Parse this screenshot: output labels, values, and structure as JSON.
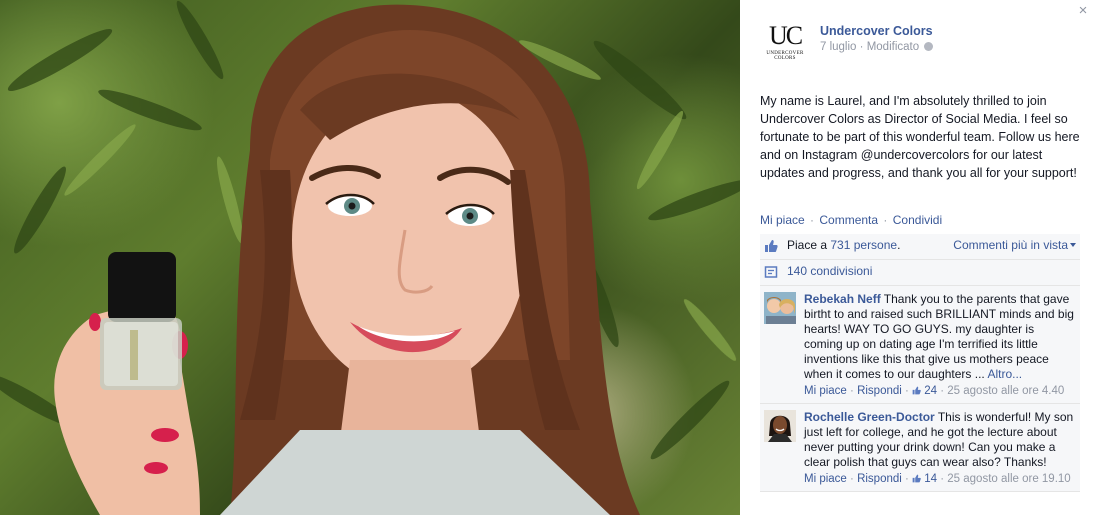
{
  "photo": {
    "subject": "photo"
  },
  "close_label": "×",
  "page": {
    "logo_text": "UC",
    "logo_subtext_1": "UNDERCOVER",
    "logo_subtext_2": "COLORS",
    "name": "Undercover Colors",
    "date": "7 luglio",
    "separator": "·",
    "edited": "Modificato"
  },
  "post": {
    "text": "My name is Laurel, and I'm absolutely thrilled to join Undercover Colors as Director of Social Media. I feel so fortunate to be part of this wonderful team. Follow us here and on Instagram @undercovercolors for our latest updates and progress, and thank you all for your support!"
  },
  "actions": {
    "like": "Mi piace",
    "comment": "Commenta",
    "share": "Condividi",
    "sep": "·"
  },
  "likes": {
    "prefix": "Piace a ",
    "count_link": "731 persone",
    "suffix": ".",
    "order_label": "Commenti più in vista"
  },
  "shares": {
    "label": "140 condivisioni"
  },
  "comments": [
    {
      "author": "Rebekah Neff",
      "text": " Thank you to the parents that gave birtht to and raised such BRILLIANT minds and big hearts! WAY TO GO GUYS. my daughter is coming up on dating age I'm terrified its little inventions like this that give us mothers peace when it comes to our daughters ... ",
      "more": "Altro...",
      "like": "Mi piace",
      "reply": "Rispondi",
      "likes": "24",
      "time": "25 agosto alle ore 4.40",
      "sep": " · "
    },
    {
      "author": "Rochelle Green-Doctor",
      "text": " This is wonderful! My son just left for college, and he got the lecture about never putting your drink down! Can you make a clear polish that guys can wear also? Thanks!",
      "more": "",
      "like": "Mi piace",
      "reply": "Rispondi",
      "likes": "14",
      "time": "25 agosto alle ore 19.10",
      "sep": " · "
    }
  ],
  "colors": {
    "link": "#3b5998",
    "muted": "#9197a3",
    "ufi_bg": "#f6f7f9"
  }
}
